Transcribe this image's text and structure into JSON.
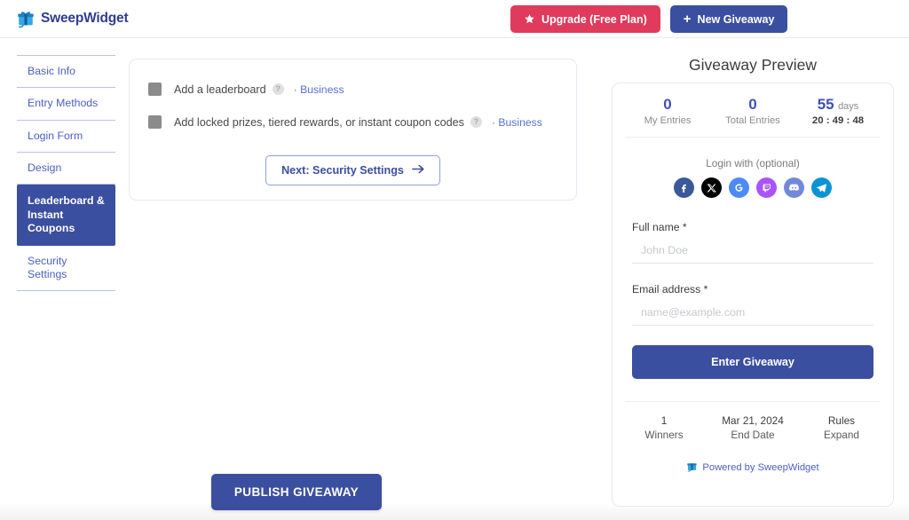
{
  "header": {
    "brand": "SweepWidget",
    "brand_icon": "gift-box-icon",
    "upgrade_label": "Upgrade (Free Plan)",
    "upgrade_icon": "star-icon",
    "upgrade_color": "#e03a5d",
    "new_giveaway_label": "New Giveaway",
    "new_giveaway_icon": "plus-icon",
    "new_giveaway_color": "#3b4fa0"
  },
  "sidebar": {
    "items": [
      {
        "label": "Basic Info",
        "active": false
      },
      {
        "label": "Entry Methods",
        "active": false
      },
      {
        "label": "Login Form",
        "active": false
      },
      {
        "label": "Design",
        "active": false
      },
      {
        "label": "Leaderboard & Instant Coupons",
        "active": true
      },
      {
        "label": "Security Settings",
        "active": false
      }
    ]
  },
  "main": {
    "options": [
      {
        "label": "Add a leaderboard",
        "help_icon": "question-mark-icon",
        "badge": "· Business",
        "checked": false,
        "disabled": true
      },
      {
        "label": "Add locked prizes, tiered rewards, or instant coupon codes",
        "help_icon": "question-mark-icon",
        "badge": "· Business",
        "checked": false,
        "disabled": true
      }
    ],
    "next_label": "Next: Security Settings",
    "next_icon": "arrow-right-icon",
    "publish_label": "PUBLISH GIVEAWAY"
  },
  "preview": {
    "title": "Giveaway Preview",
    "stats": [
      {
        "value": "0",
        "label": "My Entries"
      },
      {
        "value": "0",
        "label": "Total Entries"
      }
    ],
    "countdown": {
      "days_value": "55",
      "days_label": "days",
      "clock": "20 : 49 : 48"
    },
    "login_label": "Login with (optional)",
    "socials": [
      {
        "name": "facebook-icon",
        "color": "#3b5998"
      },
      {
        "name": "x-twitter-icon",
        "color": "#000000"
      },
      {
        "name": "google-icon",
        "color": "#4c8bf5"
      },
      {
        "name": "twitch-icon",
        "color": "#a855f7"
      },
      {
        "name": "discord-icon",
        "color": "#7289da"
      },
      {
        "name": "telegram-icon",
        "color": "#0d93d4"
      }
    ],
    "fields": [
      {
        "label": "Full name *",
        "value": "",
        "placeholder": "John Doe"
      },
      {
        "label": "Email address *",
        "value": "",
        "placeholder": "name@example.com"
      }
    ],
    "enter_label": "Enter Giveaway",
    "footer": [
      {
        "top": "1",
        "bottom": "Winners"
      },
      {
        "top": "Mar 21, 2024",
        "bottom": "End Date"
      },
      {
        "top": "Rules",
        "bottom": "Expand"
      }
    ],
    "powered_label": "Powered by SweepWidget",
    "powered_icon": "gift-box-icon"
  }
}
